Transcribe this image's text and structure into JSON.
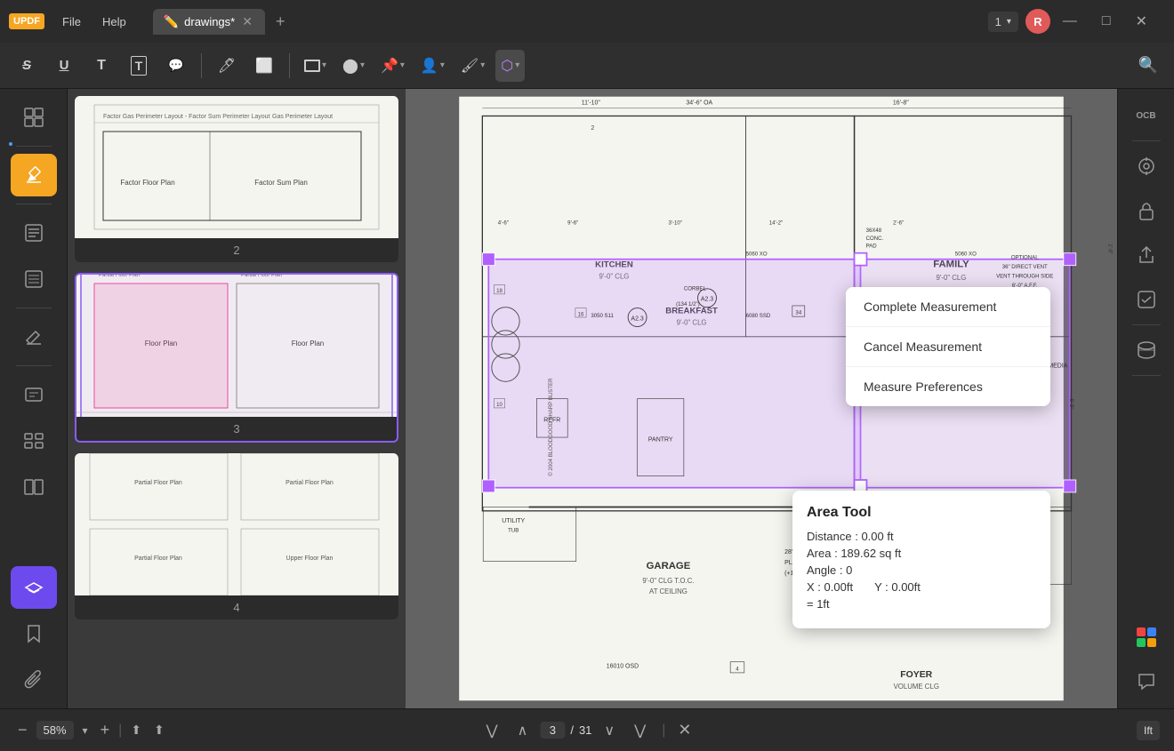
{
  "app": {
    "logo": "UPDF",
    "title": "drawings*"
  },
  "titlebar": {
    "menu": [
      "File",
      "Help"
    ],
    "tab_label": "drawings*",
    "tab_icon": "pencil-icon",
    "page_selector": "1",
    "user_initial": "R",
    "new_tab_btn": "+"
  },
  "toolbar": {
    "buttons": [
      {
        "id": "strikethrough",
        "label": "S",
        "style": "strikethrough"
      },
      {
        "id": "underline",
        "label": "U",
        "style": "underline"
      },
      {
        "id": "text-t",
        "label": "T",
        "style": "bold"
      },
      {
        "id": "text-box",
        "label": "T",
        "style": "box"
      },
      {
        "id": "text-callout",
        "label": "T"
      },
      {
        "id": "highlight",
        "label": "marker"
      },
      {
        "id": "eraser",
        "label": "eraser"
      },
      {
        "id": "shape",
        "label": "rect",
        "has_arrow": true
      },
      {
        "id": "color-picker",
        "label": "color",
        "has_arrow": true
      },
      {
        "id": "pin",
        "label": "pin",
        "has_arrow": true
      },
      {
        "id": "person",
        "label": "person",
        "has_arrow": true
      },
      {
        "id": "pen-color",
        "label": "pen",
        "has_arrow": true
      },
      {
        "id": "active-tool",
        "label": "active",
        "active": true,
        "has_arrow": true
      }
    ],
    "search_btn": "search"
  },
  "sidebar": {
    "items": [
      {
        "id": "thumbnails",
        "icon": "grid-icon"
      },
      {
        "id": "separator1"
      },
      {
        "id": "highlight-tool",
        "icon": "highlight-icon",
        "active": true
      },
      {
        "id": "separator2"
      },
      {
        "id": "notes",
        "icon": "notes-icon"
      },
      {
        "id": "list",
        "icon": "list-icon"
      },
      {
        "id": "separator3"
      },
      {
        "id": "edit",
        "icon": "edit-icon"
      },
      {
        "id": "separator4"
      },
      {
        "id": "form",
        "icon": "form-icon"
      },
      {
        "id": "organize",
        "icon": "organize-icon"
      },
      {
        "id": "compare",
        "icon": "compare-icon"
      }
    ],
    "bottom": [
      {
        "id": "layers",
        "icon": "layers-icon",
        "active": true
      },
      {
        "id": "bookmark",
        "icon": "bookmark-icon"
      },
      {
        "id": "attachment",
        "icon": "attachment-icon"
      }
    ]
  },
  "thumbnails": [
    {
      "page": 2,
      "selected": false
    },
    {
      "page": 3,
      "selected": true
    },
    {
      "page": 4,
      "selected": false
    }
  ],
  "pdf": {
    "zoom": "58%",
    "current_page": "3",
    "total_pages": "31"
  },
  "measure_panel": {
    "title": "Area Tool",
    "distance_label": "Distance :",
    "distance_value": "0.00 ft",
    "area_label": "Area :",
    "area_value": "189.62 sq ft",
    "angle_label": "Angle :",
    "angle_value": "0",
    "x_label": "X :",
    "x_value": "0.00ft",
    "y_label": "Y :",
    "y_value": "0.00ft",
    "scale_label": "= 1ft"
  },
  "context_menu": {
    "items": [
      {
        "id": "complete",
        "label": "Complete Measurement"
      },
      {
        "id": "cancel",
        "label": "Cancel Measurement"
      },
      {
        "id": "preferences",
        "label": "Measure Preferences"
      }
    ]
  },
  "right_sidebar": {
    "items": [
      {
        "id": "ocr",
        "label": "OCR"
      },
      {
        "id": "scan",
        "icon": "scan-icon"
      },
      {
        "id": "lock",
        "icon": "lock-icon"
      },
      {
        "id": "share",
        "icon": "share-icon"
      },
      {
        "id": "check",
        "icon": "check-icon"
      }
    ],
    "bottom": [
      {
        "id": "integrations",
        "icon": "grid-color-icon"
      },
      {
        "id": "chat",
        "icon": "chat-icon"
      }
    ]
  }
}
